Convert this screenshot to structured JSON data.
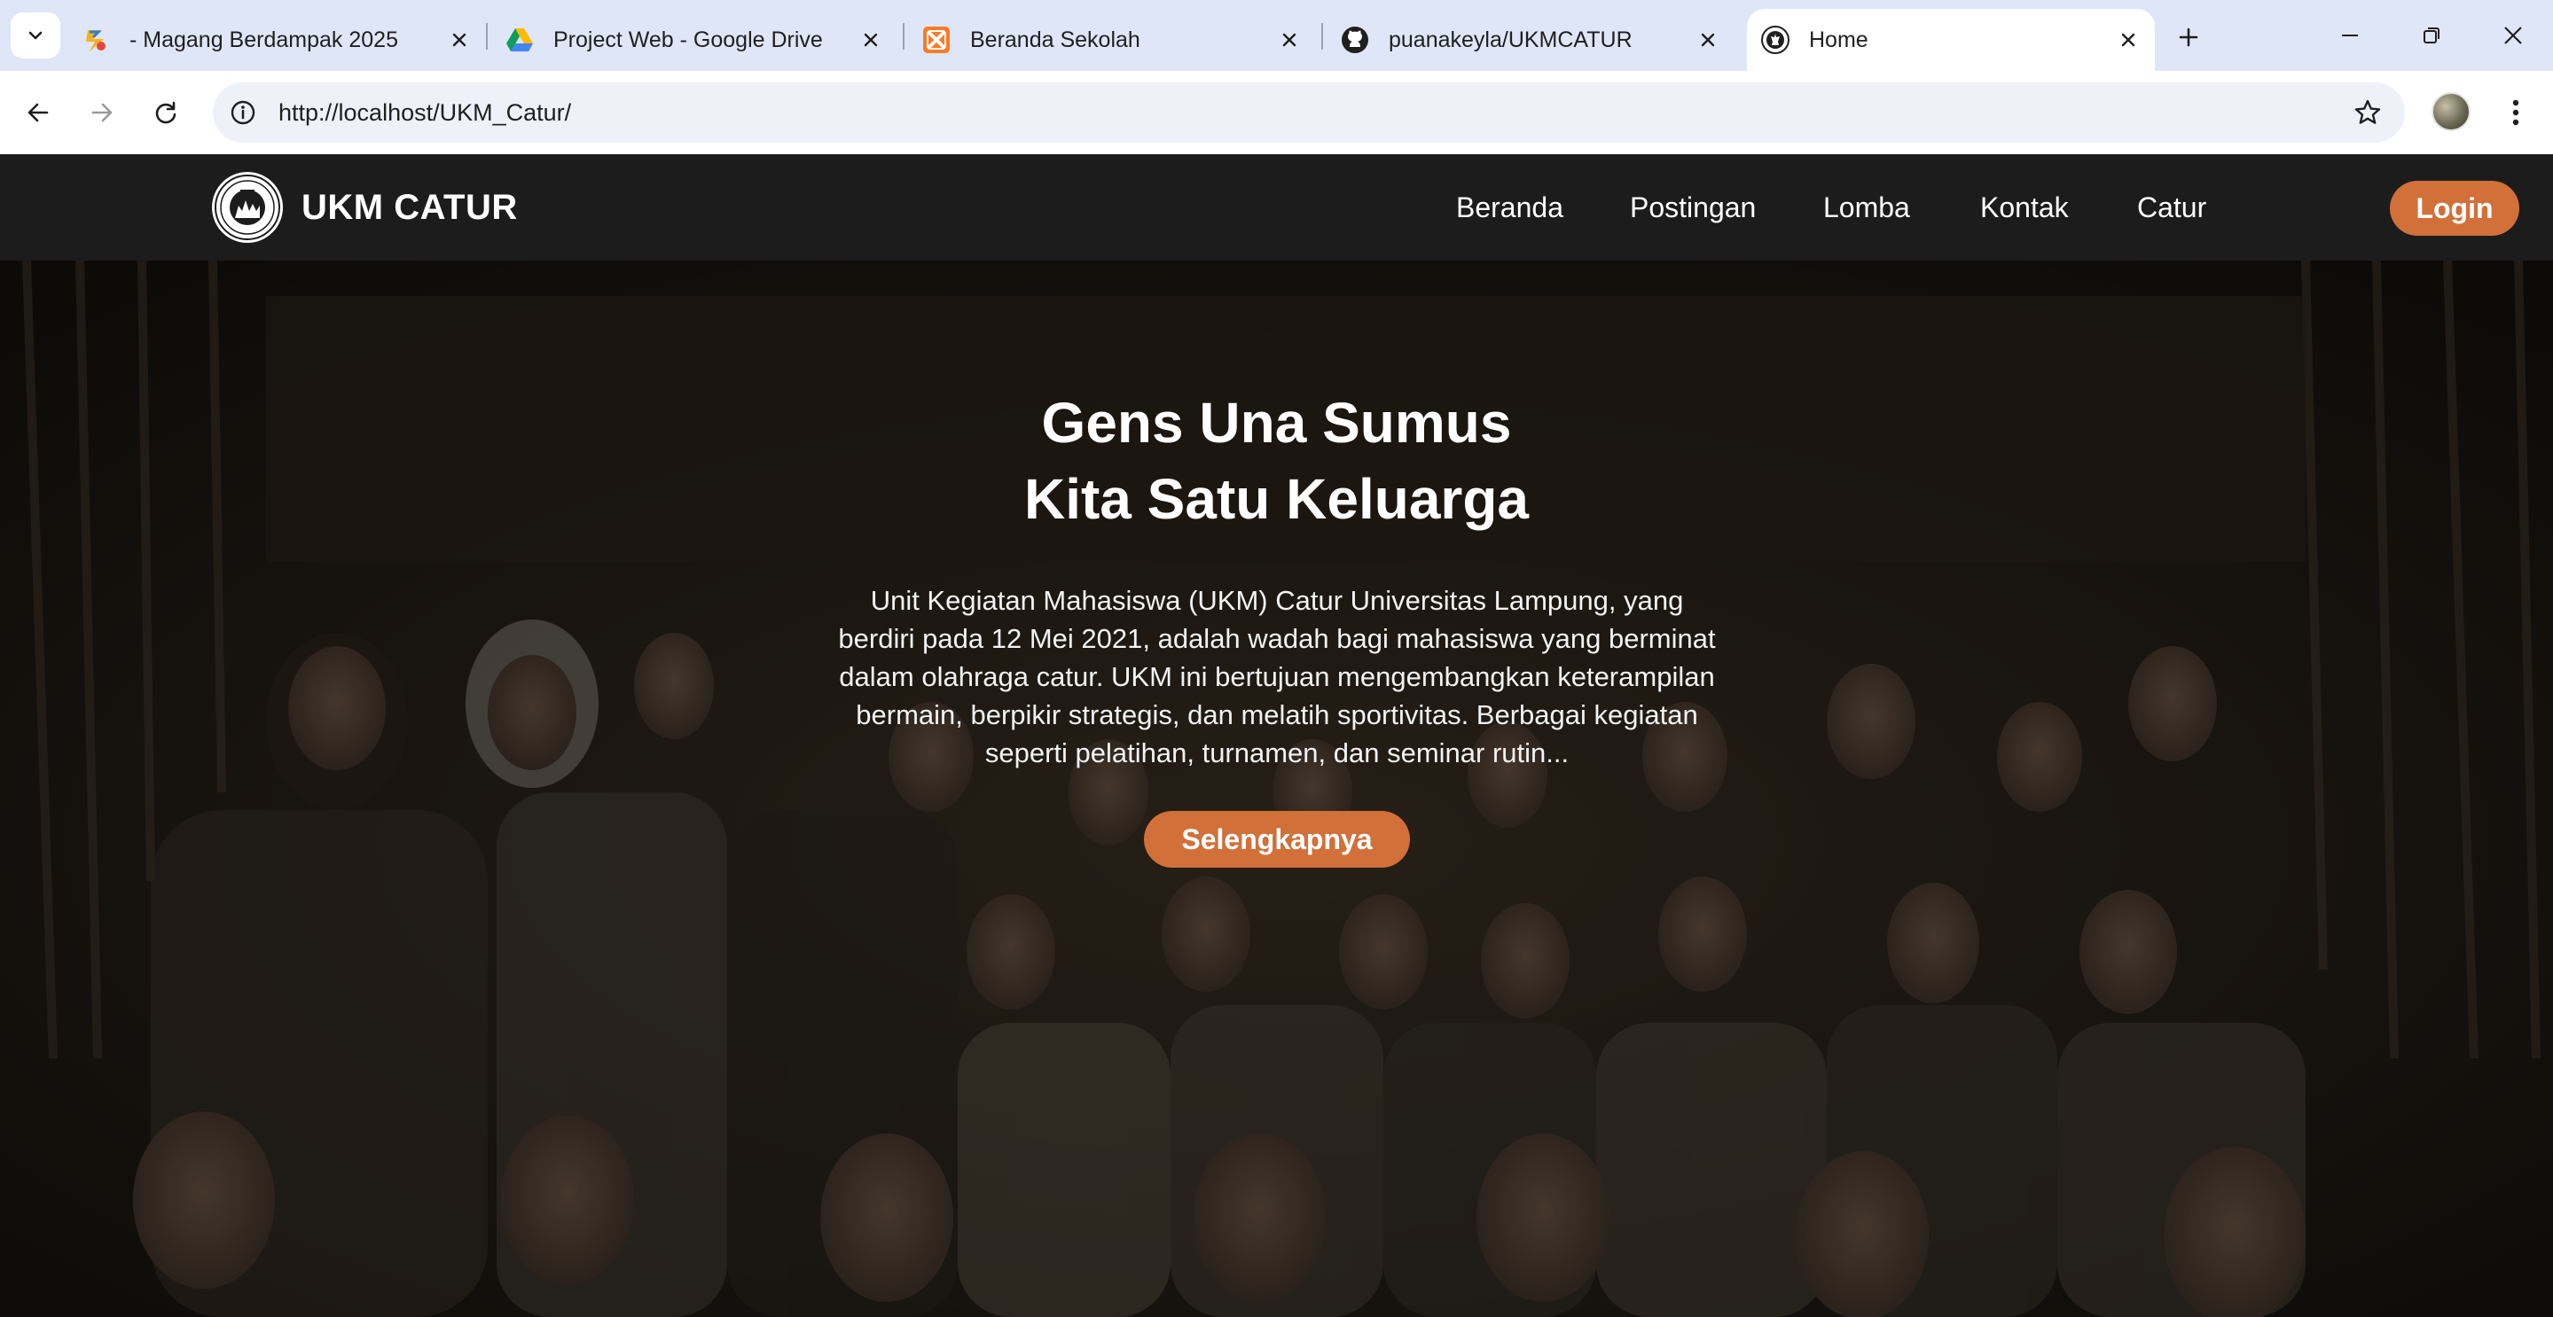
{
  "browser": {
    "tabs": [
      {
        "title": "- Magang Berdampak 2025",
        "icon": "kampus-merdeka-icon",
        "active": false
      },
      {
        "title": "Project Web - Google Drive",
        "icon": "google-drive-icon",
        "active": false
      },
      {
        "title": "Beranda Sekolah",
        "icon": "xampp-icon",
        "active": false
      },
      {
        "title": "puanakeyla/UKMCATUR",
        "icon": "github-icon",
        "active": false
      },
      {
        "title": "Home",
        "icon": "chess-logo-icon",
        "active": true
      }
    ],
    "url": "http://localhost/UKM_Catur/"
  },
  "site": {
    "brand": "UKM CATUR",
    "nav": [
      "Beranda",
      "Postingan",
      "Lomba",
      "Kontak",
      "Catur"
    ],
    "login_label": "Login",
    "accent_color": "#d2703a",
    "nav_background": "#1c1c1c"
  },
  "hero": {
    "title_line1": "Gens Una Sumus",
    "title_line2": "Kita Satu Keluarga",
    "description": "Unit Kegiatan Mahasiswa (UKM) Catur Universitas Lampung, yang berdiri pada 12 Mei 2021, adalah wadah bagi mahasiswa yang berminat dalam olahraga catur. UKM ini bertujuan mengembangkan keterampilan bermain, berpikir strategis, dan melatih sportivitas. Berbagai kegiatan seperti pelatihan, turnamen, dan seminar rutin...",
    "cta_label": "Selengkapnya"
  }
}
